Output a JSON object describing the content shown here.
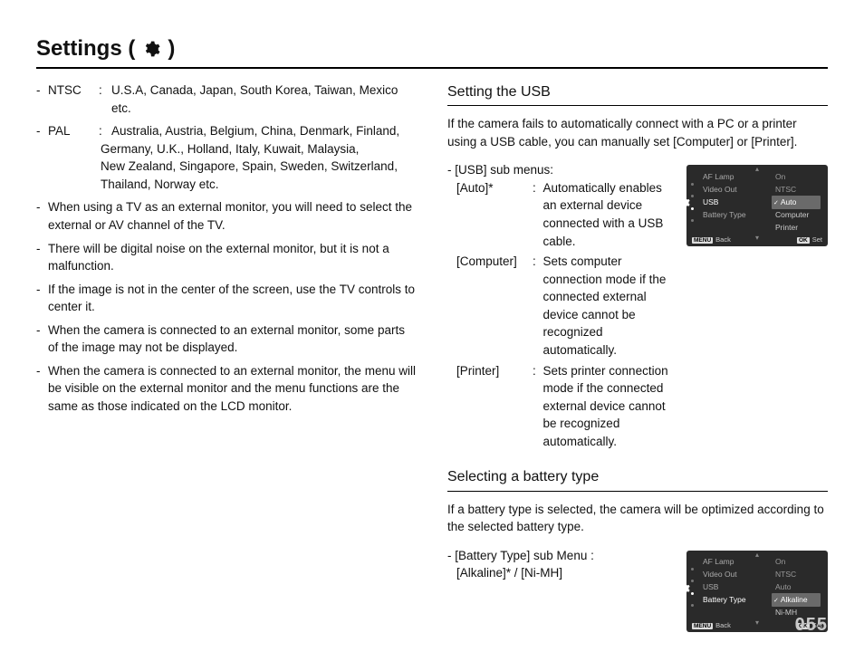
{
  "page_title_prefix": "Settings (",
  "page_title_suffix": ")",
  "icon_name": "settings-gear-icon",
  "left": {
    "ntsc_key": "NTSC",
    "ntsc_val": "U.S.A, Canada, Japan, South Korea, Taiwan, Mexico etc.",
    "pal_key": "PAL",
    "pal_val_1": "Australia, Austria, Belgium, China, Denmark, Finland,",
    "pal_val_2": "Germany, U.K., Holland, Italy, Kuwait, Malaysia,",
    "pal_val_3": "New Zealand, Singapore, Spain, Sweden, Switzerland,",
    "pal_val_4": "Thailand, Norway etc.",
    "b1": "When using a TV as an external monitor, you will need to select the external or AV channel of the TV.",
    "b2": "There will be digital noise on the external monitor, but it is not a malfunction.",
    "b3": "If the image is not in the center of the screen, use the TV controls to center it.",
    "b4": "When the camera is connected to an external monitor, some parts of the image may not be displayed.",
    "b5": "When the camera is connected to an external monitor, the menu will be visible on the external monitor and the menu functions are the same as those indicated on the LCD monitor."
  },
  "usb": {
    "heading": "Setting the USB",
    "intro": "If the camera fails to automatically connect with a PC or a printer using a USB cable, you can manually set [Computer] or [Printer].",
    "submenus_label": "[USB] sub menus:",
    "auto_k": "[Auto]*",
    "auto_v": "Automatically enables an external device connected with a USB cable.",
    "comp_k": "[Computer]",
    "comp_v": "Sets computer connection mode if the connected external device cannot be recognized automatically.",
    "prn_k": "[Printer]",
    "prn_v": "Sets printer connection mode if the connected external device cannot be recognized automatically."
  },
  "battery": {
    "heading": "Selecting a battery type",
    "intro": "If a battery type is selected, the camera will be optimized according to the selected battery type.",
    "sub_label": "[Battery Type] sub Menu :",
    "sub_values": "[Alkaline]* / [Ni-MH]"
  },
  "osd": {
    "items": {
      "af_lamp": "AF Lamp",
      "video_out": "Video Out",
      "usb": "USB",
      "battery_type": "Battery Type"
    },
    "vals": {
      "on": "On",
      "ntsc": "NTSC",
      "auto": "Auto",
      "computer": "Computer",
      "printer": "Printer",
      "alkaline": "Alkaline",
      "nimh": "Ni-MH"
    },
    "btn_back_chip": "MENU",
    "btn_back": "Back",
    "btn_set_chip": "OK",
    "btn_set": "Set"
  },
  "page_number": "055"
}
